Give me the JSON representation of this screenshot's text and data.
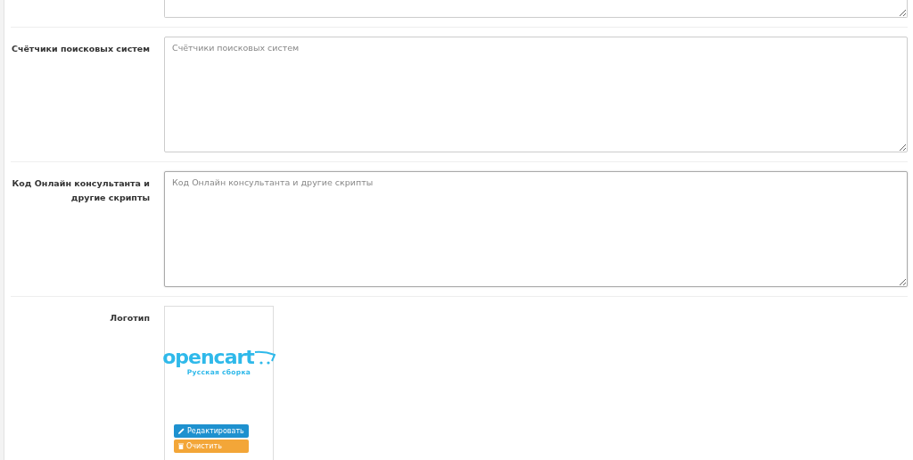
{
  "fields": [
    {
      "kind": "textarea",
      "focused": false,
      "partial": true
    },
    {
      "kind": "textarea",
      "label": "Счётчики поисковых систем",
      "placeholder": "Счётчики поисковых систем",
      "focused": false
    },
    {
      "kind": "textarea",
      "label": "Код Онлайн консультанта и другие скрипты",
      "placeholder": "Код Онлайн консультанта и другие скрипты",
      "focused": true
    },
    {
      "kind": "image",
      "label": "Логотип",
      "logo": {
        "name": "opencart",
        "tagline": "Русская сборка"
      },
      "buttons": [
        {
          "kind": "edit",
          "label": "Редактировать"
        },
        {
          "kind": "clear",
          "label": "Очистить"
        }
      ]
    }
  ]
}
